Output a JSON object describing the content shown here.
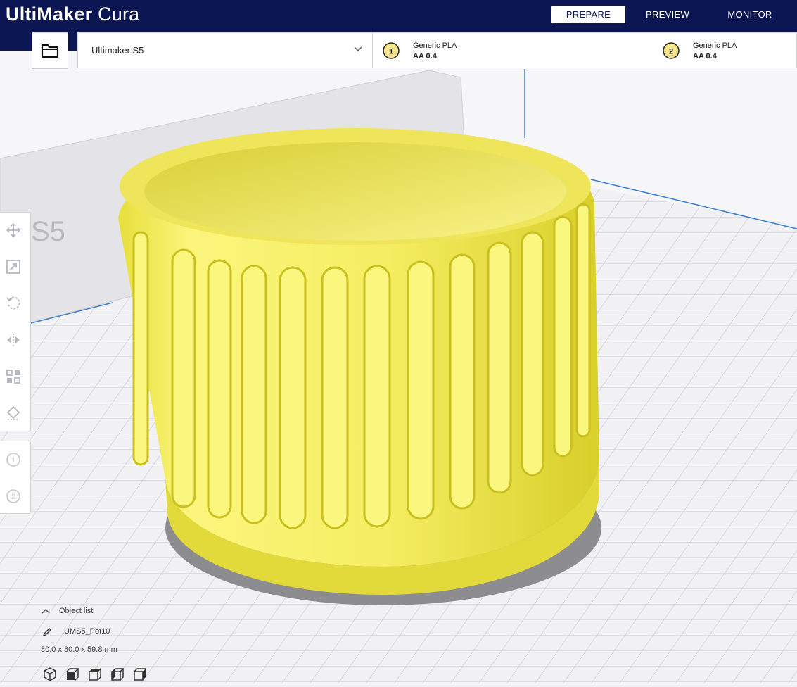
{
  "app": {
    "logo_bold": "UltiMaker",
    "logo_light": "Cura"
  },
  "stages": [
    {
      "label": "PREPARE",
      "active": true
    },
    {
      "label": "PREVIEW",
      "active": false
    },
    {
      "label": "MONITOR",
      "active": false
    }
  ],
  "printer": {
    "name": "Ultimaker S5"
  },
  "extruders": [
    {
      "number": "1",
      "material": "Generic PLA",
      "core": "AA 0.4"
    },
    {
      "number": "2",
      "material": "Generic PLA",
      "core": "AA 0.4"
    }
  ],
  "scene": {
    "build_volume_label": "S5",
    "model_color": "#f2ea5a",
    "plate_color": "#f3f3f5",
    "grid_color": "#c9c9cf",
    "axis_color": "#3b7fd4"
  },
  "left_toolbar": {
    "tools": [
      "move-icon",
      "scale-icon",
      "rotate-icon",
      "mirror-icon",
      "per-model-settings-icon",
      "support-blocker-icon"
    ],
    "extruder_buttons": [
      "1",
      "2"
    ]
  },
  "object_list": {
    "header": "Object list",
    "object_name": "UMS5_Pot10",
    "dimensions": "80.0 x 80.0 x 59.8 mm"
  },
  "view_buttons": [
    "3d-view-icon",
    "front-view-icon",
    "top-view-icon",
    "left-view-icon",
    "right-view-icon"
  ],
  "colors": {
    "topbar": "#0c1652",
    "accent": "#0c1652",
    "extruder_badge": "#f5e48a"
  }
}
